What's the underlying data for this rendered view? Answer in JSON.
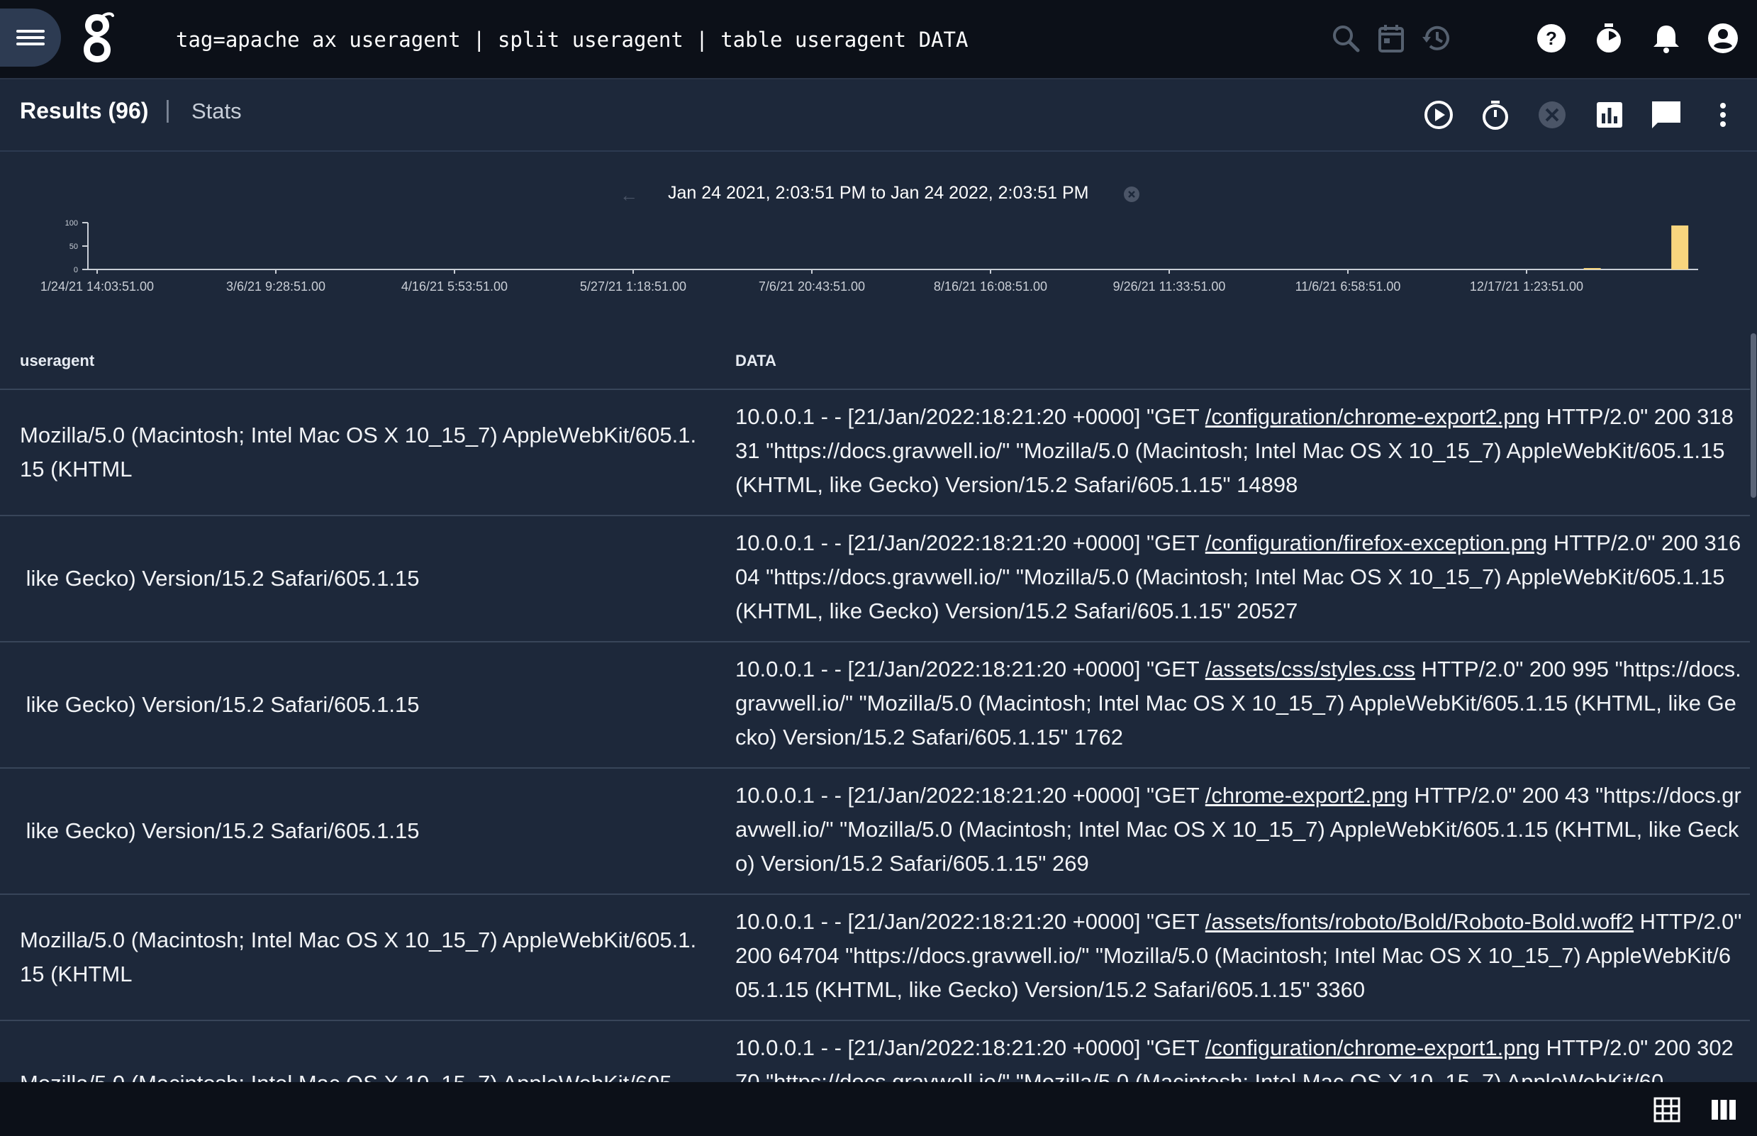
{
  "header": {
    "query": "tag=apache ax useragent | split useragent | table useragent DATA",
    "icons": [
      "menu-icon",
      "gravwell-logo",
      "search-icon",
      "calendar-icon",
      "history-icon",
      "help-icon",
      "timer-icon",
      "notifications-icon",
      "account-icon"
    ]
  },
  "results_bar": {
    "title": "Results (96)",
    "separator": "|",
    "stats_label": "Stats",
    "icons": [
      "play-icon",
      "stopwatch-icon",
      "cancel-icon",
      "chart-icon",
      "comment-icon",
      "more-vert-icon"
    ]
  },
  "timeline": {
    "range_label": "Jan 24 2021, 2:03:51 PM to Jan 24 2022, 2:03:51 PM"
  },
  "chart_data": {
    "type": "bar",
    "y_ticks": [
      "100",
      "50",
      "0"
    ],
    "ylim": [
      0,
      100
    ],
    "x_ticks": [
      "1/24/21 14:03:51.00",
      "3/6/21 9:28:51.00",
      "4/16/21 5:53:51.00",
      "5/27/21 1:18:51.00",
      "7/6/21 20:43:51.00",
      "8/16/21 16:08:51.00",
      "9/26/21 11:33:51.00",
      "11/6/21 6:58:51.00",
      "12/17/21 1:23:51.00"
    ],
    "bars": [
      {
        "x": "2022-01-01",
        "value": 2
      },
      {
        "x": "2022-01-21",
        "value": 94
      }
    ],
    "bar_color": "#f7d57e"
  },
  "table": {
    "columns": [
      "useragent",
      "DATA"
    ],
    "rows": [
      {
        "useragent": "Mozilla/5.0 (Macintosh; Intel Mac OS X 10_15_7) AppleWebKit/605.1.15 (KHTML",
        "data_pre": "10.0.0.1 - - [21/Jan/2022:18:21:20 +0000] \"GET ",
        "data_link": "/configuration/chrome-export2.png",
        "data_post": " HTTP/2.0\" 200 31831 \"https://docs.gravwell.io/\" \"Mozilla/5.0 (Macintosh; Intel Mac OS X 10_15_7) AppleWebKit/605.1.15 (KHTML, like Gecko) Version/15.2 Safari/605.1.15\" 14898"
      },
      {
        "useragent": " like Gecko) Version/15.2 Safari/605.1.15",
        "data_pre": "10.0.0.1 - - [21/Jan/2022:18:21:20 +0000] \"GET ",
        "data_link": "/configuration/firefox-exception.png",
        "data_post": " HTTP/2.0\" 200 31604 \"https://docs.gravwell.io/\" \"Mozilla/5.0 (Macintosh; Intel Mac OS X 10_15_7) AppleWebKit/605.1.15 (KHTML, like Gecko) Version/15.2 Safari/605.1.15\" 20527"
      },
      {
        "useragent": " like Gecko) Version/15.2 Safari/605.1.15",
        "data_pre": "10.0.0.1 - - [21/Jan/2022:18:21:20 +0000] \"GET ",
        "data_link": "/assets/css/styles.css",
        "data_post": " HTTP/2.0\" 200 995 \"https://docs.gravwell.io/\" \"Mozilla/5.0 (Macintosh; Intel Mac OS X 10_15_7) AppleWebKit/605.1.15 (KHTML, like Gecko) Version/15.2 Safari/605.1.15\" 1762"
      },
      {
        "useragent": " like Gecko) Version/15.2 Safari/605.1.15",
        "data_pre": "10.0.0.1 - - [21/Jan/2022:18:21:20 +0000] \"GET ",
        "data_link": "/chrome-export2.png",
        "data_post": " HTTP/2.0\" 200 43 \"https://docs.gravwell.io/\" \"Mozilla/5.0 (Macintosh; Intel Mac OS X 10_15_7) AppleWebKit/605.1.15 (KHTML, like Gecko) Version/15.2 Safari/605.1.15\" 269"
      },
      {
        "useragent": "Mozilla/5.0 (Macintosh; Intel Mac OS X 10_15_7) AppleWebKit/605.1.15 (KHTML",
        "data_pre": "10.0.0.1 - - [21/Jan/2022:18:21:20 +0000] \"GET ",
        "data_link": "/assets/fonts/roboto/Bold/Roboto-Bold.woff2",
        "data_post": " HTTP/2.0\" 200 64704 \"https://docs.gravwell.io/\" \"Mozilla/5.0 (Macintosh; Intel Mac OS X 10_15_7) AppleWebKit/605.1.15 (KHTML, like Gecko) Version/15.2 Safari/605.1.15\" 3360"
      },
      {
        "useragent": "Mozilla/5.0 (Macintosh; Intel Mac OS X 10_15_7) AppleWebKit/605.",
        "data_pre": "10.0.0.1 - - [21/Jan/2022:18:21:20 +0000] \"GET ",
        "data_link": "/configuration/chrome-export1.png",
        "data_post": " HTTP/2.0\" 200 30270 \"https://docs.gravwell.io/\" \"Mozilla/5.0 (Macintosh; Intel Mac OS X 10_15_7) AppleWebKit/60"
      }
    ]
  },
  "footer": {
    "icons": [
      "table-view-icon",
      "column-view-icon"
    ]
  }
}
